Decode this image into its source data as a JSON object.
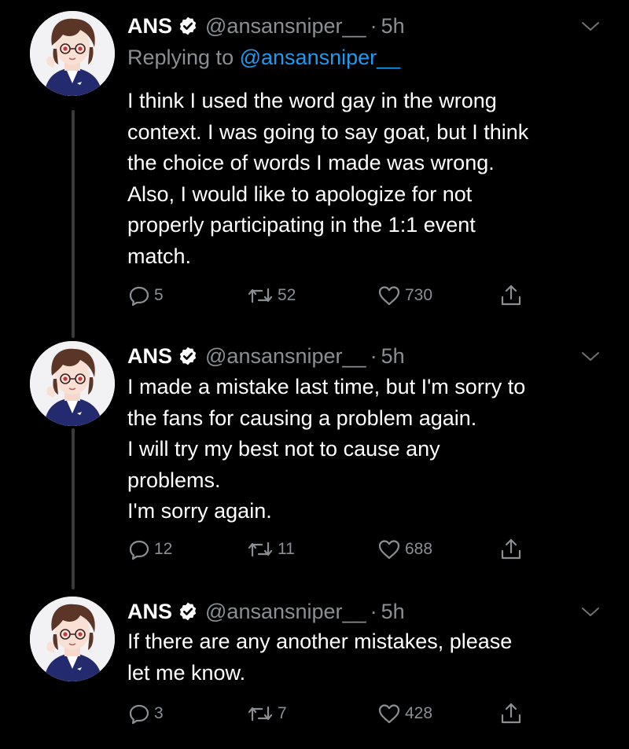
{
  "tweets": [
    {
      "name": "ANS",
      "handle": "@ansansniper__",
      "separator": "·",
      "time": "5h",
      "reply_to_prefix": "Replying to",
      "reply_to_handle": "@ansansniper__",
      "lines": [
        "I think I used the word gay in the wrong",
        "context. I was going to say goat, but I think",
        "the choice of words I made was wrong.",
        "Also, I would like to apologize for not",
        "properly participating in the 1:1 event",
        "match."
      ],
      "replies": "5",
      "retweets": "52",
      "likes": "730"
    },
    {
      "name": "ANS",
      "handle": "@ansansniper__",
      "separator": "·",
      "time": "5h",
      "lines": [
        "I made a mistake last time, but I'm sorry to",
        "the fans for causing a problem again.",
        "I will try my best not to cause any",
        "problems.",
        "I'm sorry again."
      ],
      "replies": "12",
      "retweets": "11",
      "likes": "688"
    },
    {
      "name": "ANS",
      "handle": "@ansansniper__",
      "separator": "·",
      "time": "5h",
      "lines": [
        "If there are any another mistakes, please",
        "let me know."
      ],
      "replies": "3",
      "retweets": "7",
      "likes": "428"
    }
  ],
  "colors": {
    "background": "#000000",
    "text": "#ffffff",
    "muted": "#8b8f94",
    "mention": "#1d9bf0",
    "verified_badge": "#ffffff",
    "thread_line": "#3a3a3c"
  },
  "icons": {
    "verified": "verified-badge-icon",
    "more": "chevron-down-icon",
    "reply": "reply-bubble-icon",
    "retweet": "retweet-arrows-icon",
    "like": "heart-icon",
    "share": "share-upload-icon"
  }
}
